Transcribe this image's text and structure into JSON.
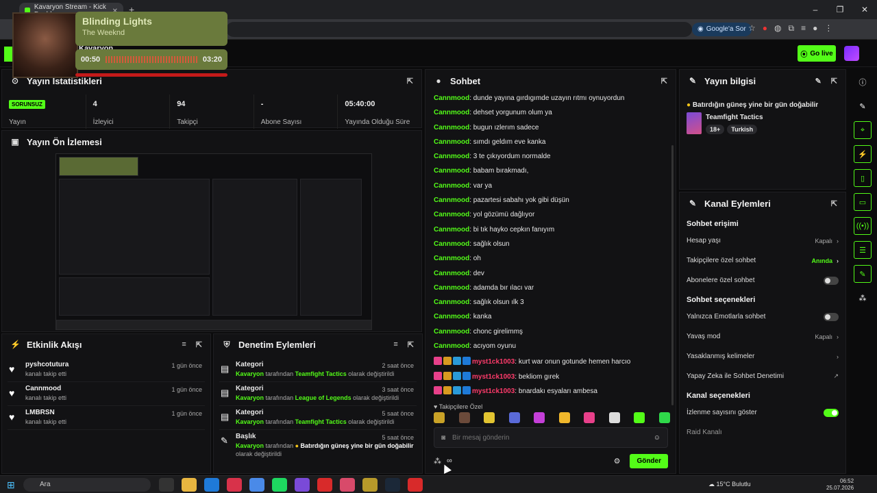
{
  "browser": {
    "tab_title": "Kavaryon Stream - Kick Dashb",
    "ask_google": "Google'a Sor"
  },
  "site": {
    "channel_name": "Kavaryon",
    "go_live": "Go live"
  },
  "now_playing": {
    "title": "Blinding Lights",
    "artist": "The Weeknd",
    "elapsed": "00:50",
    "duration": "03:20"
  },
  "stats": {
    "title": "Yayın İstatistikleri",
    "items": [
      {
        "value": "SORUNSUZ",
        "label": "Yayın"
      },
      {
        "value": "4",
        "label": "İzleyici"
      },
      {
        "value": "94",
        "label": "Takipçi"
      },
      {
        "value": "-",
        "label": "Abone Sayısı"
      },
      {
        "value": "05:40:00",
        "label": "Yayında Olduğu Süre"
      }
    ]
  },
  "preview": {
    "title": "Yayın Ön İzlemesi"
  },
  "activity": {
    "title": "Etkinlik Akışı",
    "items": [
      {
        "user": "pyshcotutura",
        "action": "kanalı takip etti",
        "time": "1 gün önce"
      },
      {
        "user": "Cannmood",
        "action": "kanalı takip etti",
        "time": "1 gün önce"
      },
      {
        "user": "LMBRSN",
        "action": "kanalı takip etti",
        "time": "1 gün önce"
      }
    ]
  },
  "moderation": {
    "title": "Denetim Eylemleri",
    "items": [
      {
        "title": "Kategori",
        "actor": "Kavaryon",
        "mid": "tarafından",
        "target": "Teamfight Tactics",
        "suffix": "olarak değiştirildi",
        "time": "2 saat önce"
      },
      {
        "title": "Kategori",
        "actor": "Kavaryon",
        "mid": "tarafından",
        "target": "League of Legends",
        "suffix": "olarak değiştirildi",
        "time": "3 saat önce"
      },
      {
        "title": "Kategori",
        "actor": "Kavaryon",
        "mid": "tarafından",
        "target": "Teamfight Tactics",
        "suffix": "olarak değiştirildi",
        "time": "5 saat önce"
      },
      {
        "title": "Başlık",
        "actor": "Kavaryon",
        "mid": "tarafından",
        "target": "Batırdığın güneş yine bir gün doğabilir",
        "suffix": "olarak değiştirildi",
        "time": "5 saat önce"
      }
    ]
  },
  "chat": {
    "title": "Sohbet",
    "messages": [
      {
        "user": "Cannmood",
        "text": "dunde yayına gırdıgımde uzayın rıtmı oynuyordun"
      },
      {
        "user": "Cannmood",
        "text": "dehset yorgunum olum ya"
      },
      {
        "user": "Cannmood",
        "text": "bugun ızlerım sadece"
      },
      {
        "user": "Cannmood",
        "text": "sımdı geldım eve kanka"
      },
      {
        "user": "Cannmood",
        "text": "3 te çıkıyordum normalde"
      },
      {
        "user": "Cannmood",
        "text": "babam bırakmadı,"
      },
      {
        "user": "Cannmood",
        "text": "var ya"
      },
      {
        "user": "Cannmood",
        "text": "pazartesi sabahı yok gibi düşün"
      },
      {
        "user": "Cannmood",
        "text": "yol gözümü dağlıyor"
      },
      {
        "user": "Cannmood",
        "text": "bi tık hayko cepkın fanıyım"
      },
      {
        "user": "Cannmood",
        "text": "sağlık olsun"
      },
      {
        "user": "Cannmood",
        "text": "oh"
      },
      {
        "user": "Cannmood",
        "text": "dev"
      },
      {
        "user": "Cannmood",
        "text": "adamda bır ılacı var"
      },
      {
        "user": "Cannmood",
        "text": "sağlık olsun ılk 3"
      },
      {
        "user": "Cannmood",
        "text": "kanka"
      },
      {
        "user": "Cannmood",
        "text": "chonc girelimmş"
      },
      {
        "user": "Cannmood",
        "text": "acıyom oyunu"
      }
    ],
    "sub_messages": [
      {
        "user": "myst1ck1003",
        "text": "kurt war onun gotunde hemen harcıo"
      },
      {
        "user": "myst1ck1003",
        "text": "bekliom gırek"
      },
      {
        "user": "myst1ck1003",
        "text": "bnardakı esyaları ambesa"
      }
    ],
    "followers_only": "Takipçilere Özel",
    "input_placeholder": "Bir mesaj gönderin",
    "infinity": "∞",
    "send": "Gönder"
  },
  "stream_info": {
    "title": "Yayın bilgisi",
    "stream_title": "Batırdığın güneş yine bir gün doğabilir",
    "game": "Teamfight Tactics",
    "tags": [
      "18+",
      "Turkish"
    ]
  },
  "channel_actions": {
    "title": "Kanal Eylemleri",
    "chat_access": "Sohbet erişimi",
    "account_age": "Hesap yaşı",
    "account_age_val": "Kapalı",
    "followers_chat": "Takipçilere özel sohbet",
    "followers_chat_val": "Anında",
    "subs_chat": "Abonelere özel sohbet",
    "chat_options": "Sohbet seçenekleri",
    "emote_only": "Yalnızca Emotlarla sohbet",
    "slow_mode": "Yavaş mod",
    "slow_mode_val": "Kapalı",
    "banned_words": "Yasaklanmış kelimeler",
    "ai_mod": "Yapay Zeka ile Sohbet Denetimi",
    "channel_options": "Kanal seçenekleri",
    "show_views": "İzlenme sayısını göster",
    "raid": "Raid Kanalı"
  },
  "taskbar": {
    "search": "Ara",
    "weather": "15°C Bulutlu",
    "time": "06:52",
    "date": "25.07.2026"
  },
  "colors": {
    "accent": "#53fc18",
    "sub_user": "#ff3b6b",
    "panel": "#121214"
  }
}
